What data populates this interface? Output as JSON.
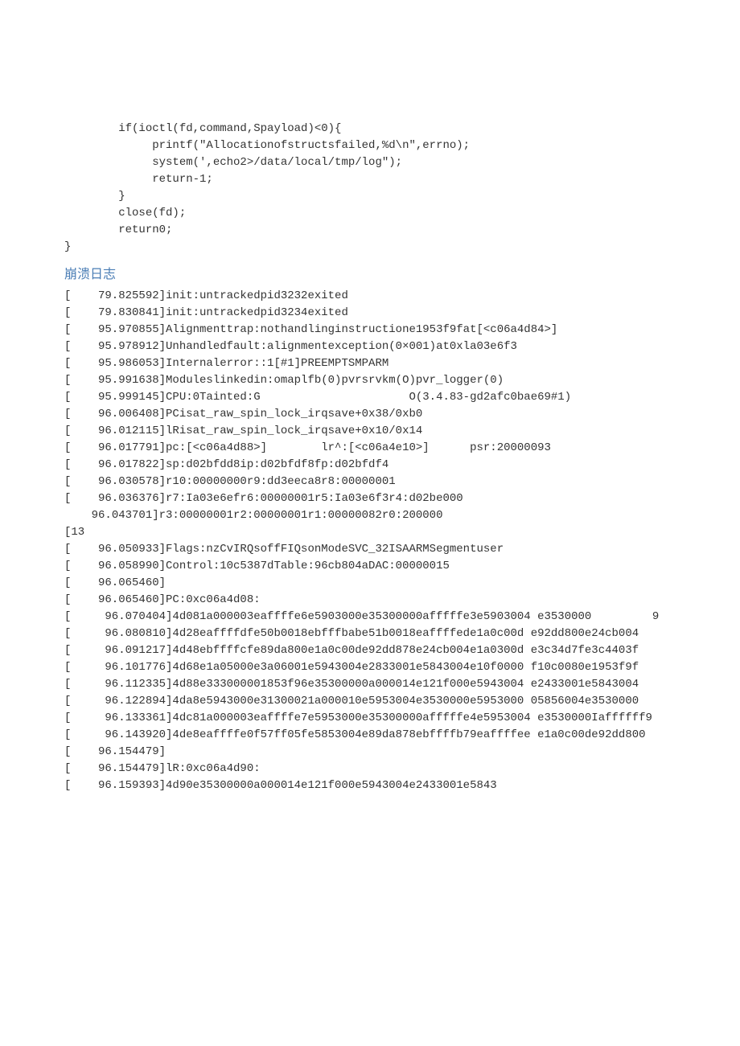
{
  "code": "        if(ioctl(fd,command,Spayload)<0){\n             printf(\"Allocationofstructsfailed,%d\\n\",errno);\n             system(',echo2>/data/local/tmp/log\");\n             return-1;\n        }\n        close(fd);\n        return0;\n}",
  "section_title": "崩溃日志",
  "log": "[    79.825592]init:untrackedpid3232exited\n[    79.830841]init:untrackedpid3234exited\n[    95.970855]Alignmenttrap:nothandlinginstructione1953f9fat[<c06a4d84>]\n[    95.978912]Unhandledfault:alignmentexception(0×001)at0xla03e6f3\n[    95.986053]Internalerror::1[#1]PREEMPTSMPARM\n[    95.991638]Moduleslinkedin:omaplfb(0)pvrsrvkm(O)pvr_logger(0)\n[    95.999145]CPU:0Tainted:G                      O(3.4.83-gd2afc0bae69#1)\n[    96.006408]PCisat_raw_spin_lock_irqsave+0x38/0xb0\n[    96.012115]lRisat_raw_spin_lock_irqsave+0x10/0x14\n[    96.017791]pc:[<c06a4d88>]        lr^:[<c06a4e10>]      psr:20000093\n[    96.017822]sp:d02bfdd8ip:d02bfdf8fp:d02bfdf4\n[    96.030578]r10:00000000r9:dd3eeca8r8:00000001\n[    96.036376]r7:Ia03e6efr6:00000001r5:Ia03e6f3r4:d02be000\n    96.043701]r3:00000001r2:00000001r1:00000082r0:200000\n[13\n[    96.050933]Flags:nzCvIRQsoffFIQsonModeSVC_32ISAARMSegmentuser\n[    96.058990]Control:10c5387dTable:96cb804aDAC:00000015\n[    96.065460]\n[    96.065460]PC:0xc06a4d08:\n[     96.070404]4d081a000003eaffffe6e5903000e35300000afffffe3e5903004 e3530000         9\n[     96.080810]4d28eaffffdfe50b0018ebfffbabe51b0018eaffffede1a0c00d e92dd800e24cb004\n[     96.091217]4d48ebffffcfe89da800e1a0c00de92dd878e24cb004e1a0300d e3c34d7fe3c4403f\n[     96.101776]4d68e1a05000e3a06001e5943004e2833001e5843004e10f0000 f10c0080e1953f9f\n[     96.112335]4d88e333000001853f96e35300000a000014e121f000e5943004 e2433001e5843004\n[     96.122894]4da8e5943000e31300021a000010e5953004e3530000e5953000 05856004e3530000\n[     96.133361]4dc81a000003eaffffe7e5953000e35300000afffffe4e5953004 e3530000Iaffffff9\n[     96.143920]4de8eaffffe0f57ff05fe5853004e89da878ebffffb79eaffffee e1a0c00de92dd800\n[    96.154479]\n[    96.154479]lR:0xc06a4d90:\n[    96.159393]4d90e35300000a000014e121f000e5943004e2433001e5843"
}
